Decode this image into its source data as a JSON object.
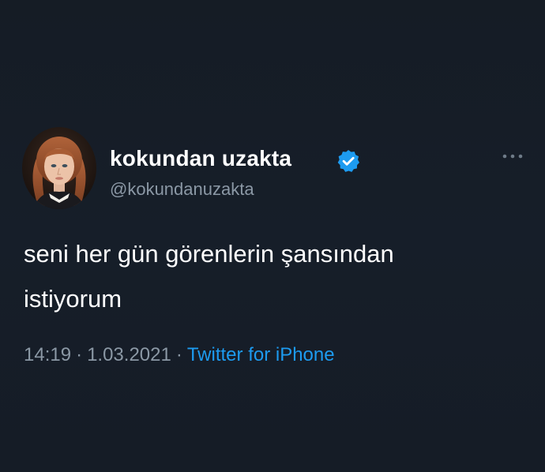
{
  "user": {
    "display_name": "kokundan uzakta",
    "handle": "@kokundanuzakta",
    "verified": true,
    "avatar_icon": "avatar-portrait"
  },
  "tweet": {
    "lines": [
      "seni her gün görenlerin şansından",
      "istiyorum"
    ]
  },
  "meta": {
    "time": "14:19",
    "separator": "·",
    "date": "1.03.2021",
    "source": "Twitter for iPhone"
  },
  "icons": {
    "verified": "verified-badge-icon",
    "more": "more-options-icon"
  },
  "colors": {
    "background": "#15202b",
    "secondary_text": "#8b98a5",
    "accent": "#1d9bf0"
  }
}
